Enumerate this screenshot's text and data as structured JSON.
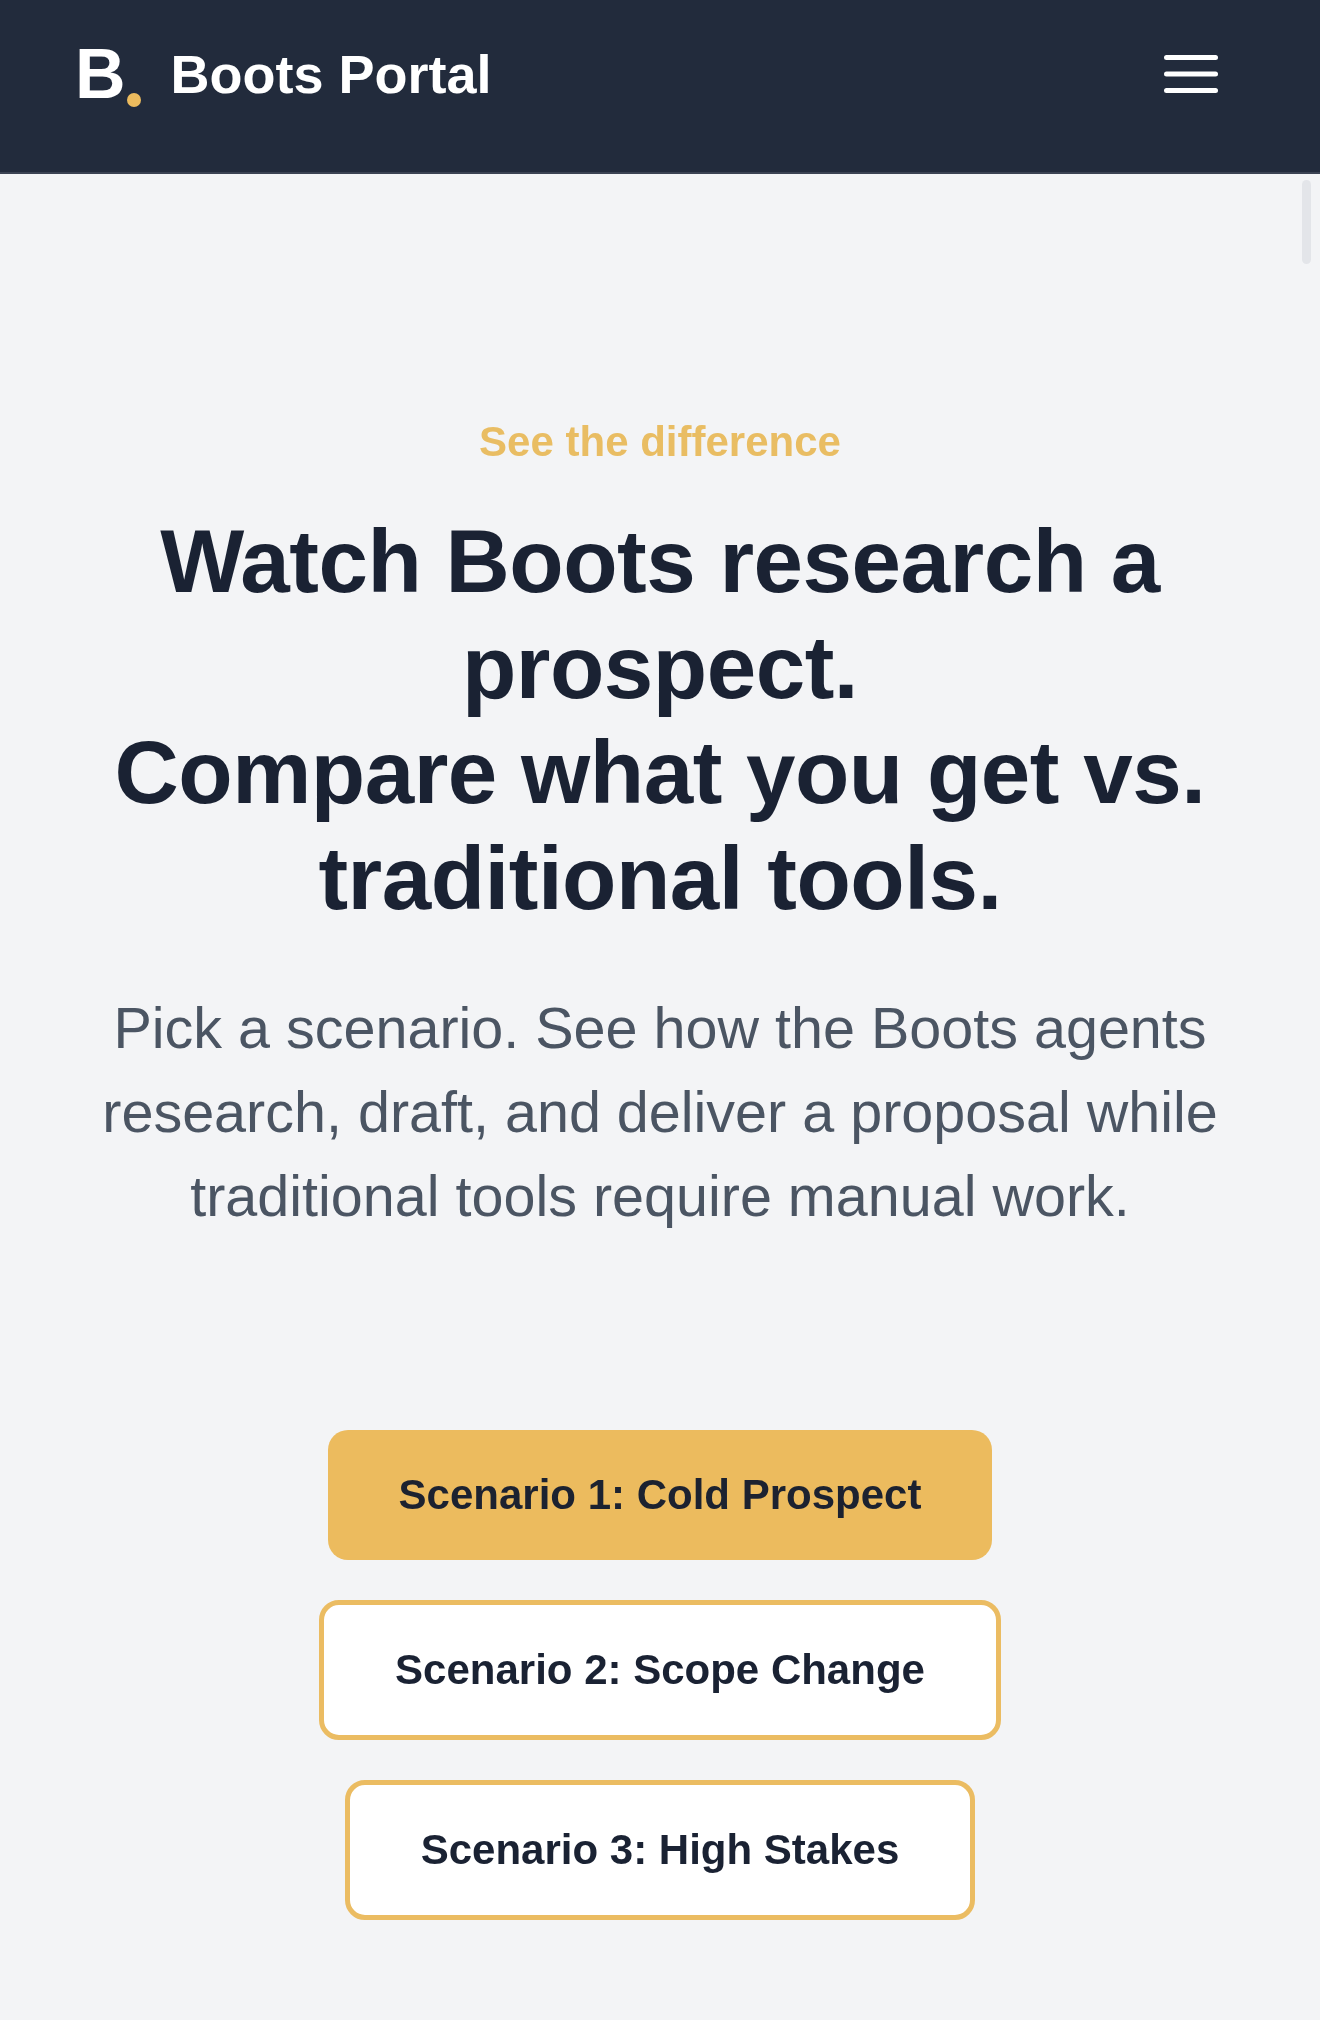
{
  "header": {
    "logo": {
      "letter": "B"
    },
    "title": "Boots Portal"
  },
  "hero": {
    "eyebrow": "See the difference",
    "heading_lines": [
      "Watch Boots research a prospect.",
      "Compare what you get vs. traditional tools."
    ],
    "description": "Pick a scenario. See how the Boots agents research, draft, and deliver a proposal while traditional tools require manual work."
  },
  "scenarios": [
    {
      "label": "Scenario 1: Cold Prospect",
      "selected": true
    },
    {
      "label": "Scenario 2: Scope Change",
      "selected": false
    },
    {
      "label": "Scenario 3: High Stakes",
      "selected": false
    }
  ]
}
